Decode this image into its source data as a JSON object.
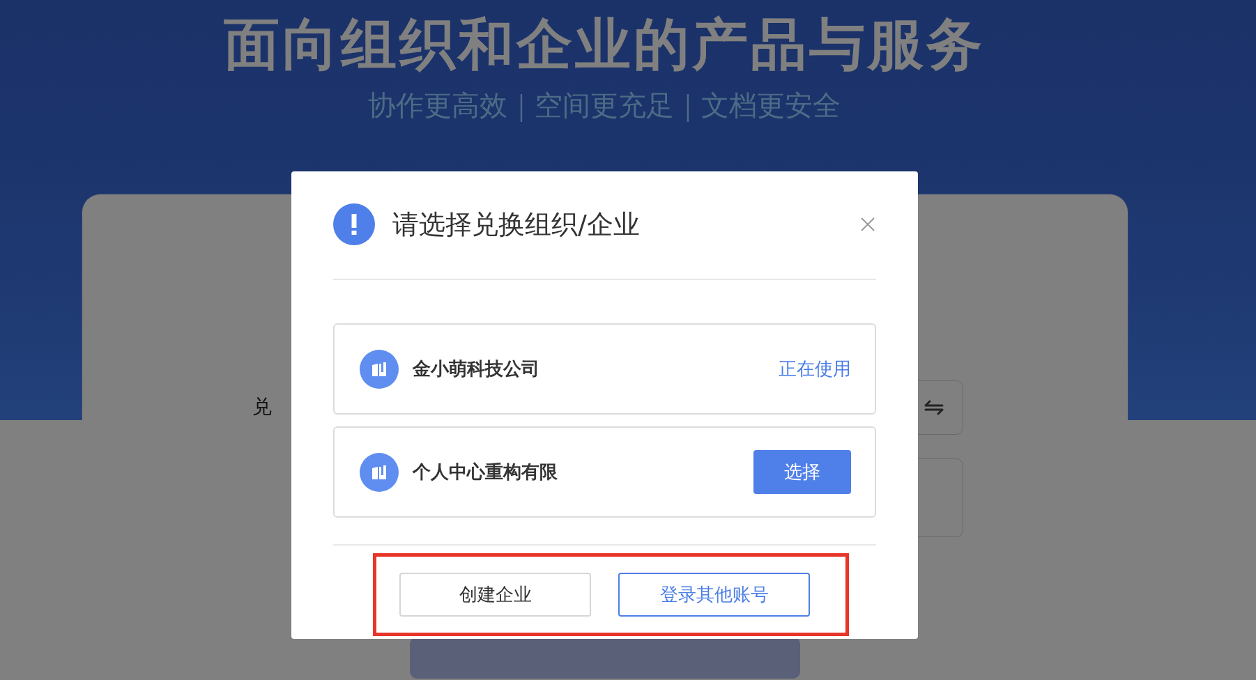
{
  "page": {
    "headline": "面向组织和企业的产品与服务",
    "tagline": "协作更高效｜空间更充足｜文档更安全"
  },
  "form": {
    "rows": [
      {
        "label": "兑",
        "kind": "swap"
      },
      {
        "kind": "plain"
      }
    ]
  },
  "dialog": {
    "title": "请选择兑换组织/企业",
    "organizations": [
      {
        "name": "金小萌科技公司",
        "current": true,
        "status": "正在使用"
      },
      {
        "name": "个人中心重构有限",
        "current": false,
        "action": "选择"
      }
    ],
    "buttons": [
      {
        "label": "创建企业",
        "primary": false
      },
      {
        "label": "登录其他账号",
        "primary": true
      }
    ],
    "annotation": {
      "kind": "highlight"
    }
  }
}
